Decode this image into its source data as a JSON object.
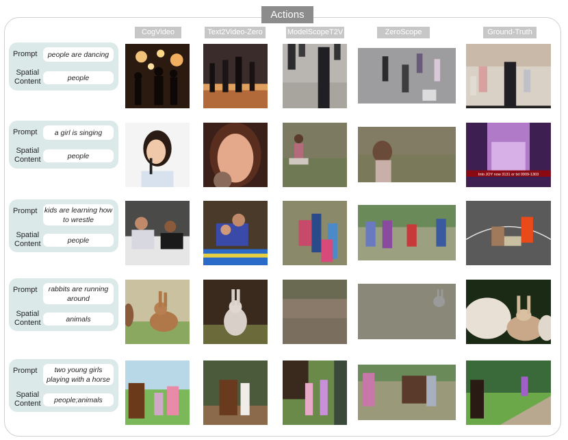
{
  "title": "Actions",
  "columns": [
    "CogVideo",
    "Text2Video-Zero",
    "ModelScopeT2V",
    "ZeroScope",
    "Ground-Truth"
  ],
  "labels": {
    "prompt": "Prompt",
    "spatial": "Spatial",
    "content": "Content"
  },
  "rows": [
    {
      "prompt": "people are dancing",
      "spatial_content": "people"
    },
    {
      "prompt": "a girl is singing",
      "spatial_content": "people"
    },
    {
      "prompt": "kids are learning how to wrestle",
      "spatial_content": "people"
    },
    {
      "prompt": "rabbits are running around",
      "spatial_content": "animals"
    },
    {
      "prompt": "two young girls playing with a horse",
      "spatial_content": "people;animals"
    }
  ],
  "overlay_text": {
    "groundtruth_row2": "Into JOY now 3131 or txt 0909-1303"
  }
}
